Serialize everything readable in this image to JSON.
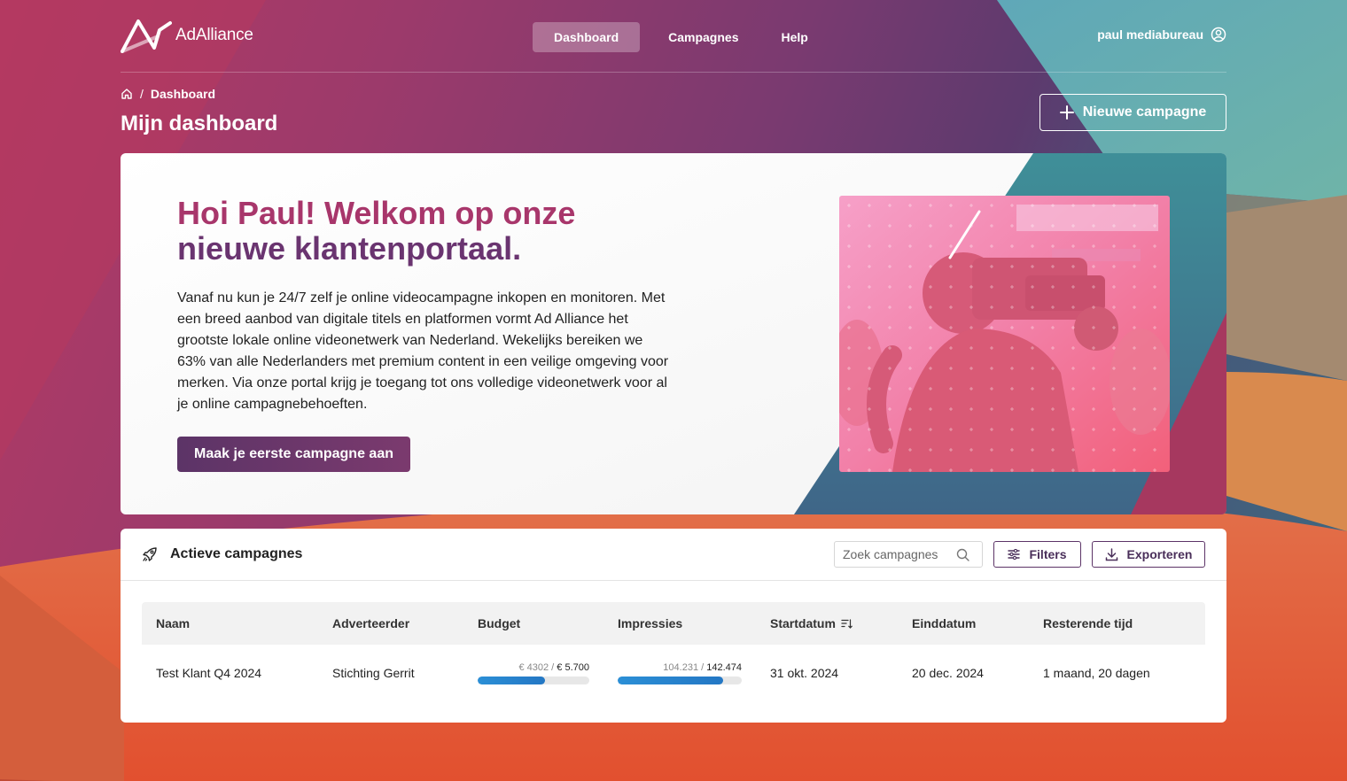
{
  "brand": {
    "name": "AdAlliance"
  },
  "nav": {
    "items": [
      {
        "label": "Dashboard",
        "active": true
      },
      {
        "label": "Campagnes",
        "active": false
      },
      {
        "label": "Help",
        "active": false
      }
    ]
  },
  "user": {
    "name": "paul mediabureau",
    "icon": "user-circle-icon"
  },
  "breadcrumb": {
    "home_icon": "home-icon",
    "separator": "/",
    "current": "Dashboard"
  },
  "page": {
    "title": "Mijn dashboard"
  },
  "actions": {
    "new_campaign_label": "Nieuwe campagne"
  },
  "hero": {
    "title_line1": "Hoi Paul! Welkom op onze",
    "title_line2": "nieuwe klantenportaal.",
    "body": "Vanaf nu kun je 24/7 zelf je online videocampagne inkopen en monitoren. Met een breed aanbod van digitale titels en platformen vormt Ad Alliance het grootste lokale online videonetwerk van Nederland. Wekelijks bereiken we 63% van alle Nederlanders met premium content in een veilige omgeving voor merken. Via onze portal krijg je toegang tot ons volledige videonetwerk voor al je online campagnebehoeften.",
    "cta_label": "Maak je eerste campagne aan"
  },
  "campaigns": {
    "title": "Actieve campagnes",
    "title_icon": "rocket-icon",
    "search_placeholder": "Zoek campagnes",
    "filters_label": "Filters",
    "export_label": "Exporteren",
    "columns": [
      "Naam",
      "Adverteerder",
      "Budget",
      "Impressies",
      "Startdatum",
      "Einddatum",
      "Resterende tijd"
    ],
    "rows": [
      {
        "name": "Test Klant Q4 2024",
        "advertiser": "Stichting Gerrit",
        "budget_spent": "€ 4302",
        "budget_total": "€ 5.700",
        "budget_fraction": 0.6,
        "impressions_done": "104.231",
        "impressions_total": "142.474",
        "impressions_fraction": 0.85,
        "start": "31 okt. 2024",
        "end": "20 dec. 2024",
        "remaining": "1 maand, 20 dagen"
      }
    ]
  },
  "colors": {
    "accent_pink": "#a8366b",
    "accent_purple": "#6a3470",
    "progress_blue": "#2b8fd6"
  }
}
